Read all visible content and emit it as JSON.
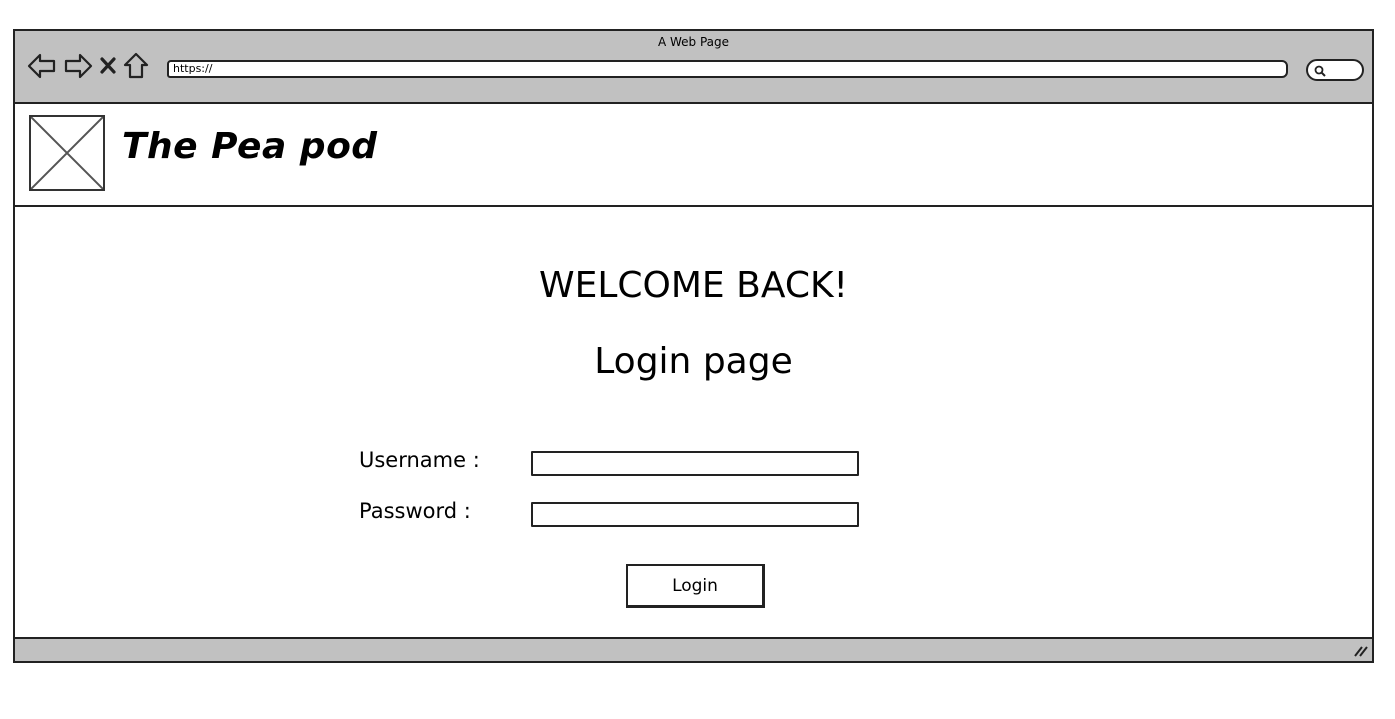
{
  "browser": {
    "window_title": "A Web Page",
    "url": "https://",
    "chrome_color": "#c1c1c1",
    "nav_icons": [
      "back-arrow-icon",
      "forward-arrow-icon",
      "close-x-icon",
      "home-icon"
    ],
    "search_icon": "search-icon"
  },
  "header": {
    "site_title": "The Pea pod",
    "logo": "image-placeholder-icon"
  },
  "main": {
    "welcome": "WELCOME BACK!",
    "heading": "Login page",
    "username_label": "Username :",
    "password_label": "Password :",
    "username_value": "",
    "password_value": "",
    "login_button": "Login"
  }
}
